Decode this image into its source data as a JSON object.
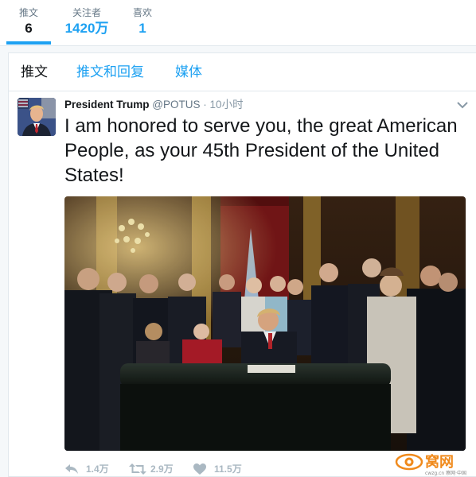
{
  "profile_stats": {
    "tweets": {
      "label": "推文",
      "value": "6"
    },
    "following": {
      "label": "关注者",
      "value": "1420万"
    },
    "likes": {
      "label": "喜欢",
      "value": "1"
    }
  },
  "timeline_tabs": {
    "tweets": "推文",
    "tweets_and_replies": "推文和回复",
    "media": "媒体"
  },
  "tweet": {
    "author_name": "President Trump",
    "author_handle": "@POTUS",
    "separator": "·",
    "timestamp": "10小时",
    "text": "I am honored to serve you, the great American People, as your 45th President of the United States!",
    "actions": {
      "reply_count": "1.4万",
      "retweet_count": "2.9万",
      "like_count": "11.5万"
    }
  },
  "watermark": {
    "logo_text": "窝网",
    "sub_text": "cwzg.cn 察网·中国"
  },
  "colors": {
    "accent": "#1da1f2",
    "text": "#14171a",
    "muted": "#657786",
    "border": "#e1e8ed",
    "watermark_orange": "#f08a1c"
  },
  "icons": {
    "reply": "reply-arrow-icon",
    "retweet": "retweet-icon",
    "like": "heart-icon",
    "caret": "chevron-down-icon"
  }
}
